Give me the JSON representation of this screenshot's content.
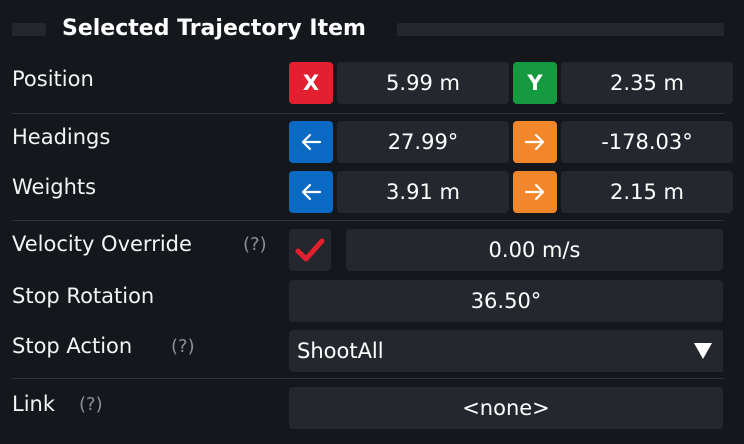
{
  "panel": {
    "title": "Selected Trajectory Item"
  },
  "position": {
    "label": "Position",
    "x_tag": "X",
    "x_value": "5.99 m",
    "y_tag": "Y",
    "y_value": "2.35 m"
  },
  "headings": {
    "label": "Headings",
    "start_value": "27.99°",
    "end_value": "-178.03°"
  },
  "weights": {
    "label": "Weights",
    "start_value": "3.91 m",
    "end_value": "2.15 m"
  },
  "velocity_override": {
    "label": "Velocity Override",
    "help": "(?)",
    "checked": true,
    "value": "0.00 m/s"
  },
  "stop_rotation": {
    "label": "Stop Rotation",
    "value": "36.50°"
  },
  "stop_action": {
    "label": "Stop Action",
    "help": "(?)",
    "selected": "ShootAll"
  },
  "link": {
    "label": "Link",
    "help": "(?)",
    "value": "<none>"
  },
  "colors": {
    "x_red": "#e3202f",
    "y_green": "#169a3f",
    "start_blue": "#0a69c2",
    "end_orange": "#f2862a",
    "check_red": "#e3202f"
  },
  "icons": {
    "start": "arrow-left-icon",
    "end": "arrow-right-icon",
    "check": "checkmark-icon",
    "dropdown": "triangle-down-icon"
  }
}
